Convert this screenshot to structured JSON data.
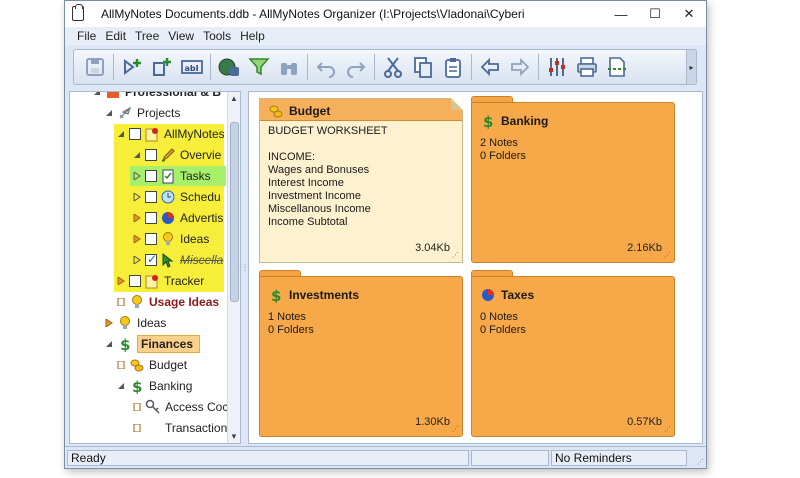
{
  "window": {
    "title": "AllMyNotes Documents.ddb - AllMyNotes Organizer (I:\\Projects\\Vladonai\\Cyberi",
    "controls": {
      "minimize": "—",
      "maximize": "☐",
      "close": "✕"
    }
  },
  "menu": [
    "File",
    "Edit",
    "Tree",
    "View",
    "Tools",
    "Help"
  ],
  "toolbar": {
    "buttons": [
      {
        "name": "save-icon",
        "color": "#8da2bf"
      },
      {
        "name": "add-note-icon",
        "color": "#2c8a2c"
      },
      {
        "name": "add-child-note-icon",
        "color": "#2c8a2c"
      },
      {
        "name": "rename-icon",
        "color": "#4a6a9a"
      },
      {
        "name": "web-search-icon",
        "color": "#2c8a2c"
      },
      {
        "name": "filter-search-icon",
        "color": "#2c8a2c"
      },
      {
        "name": "find-icon",
        "color": "#8da2bf"
      },
      {
        "name": "undo-icon",
        "color": "#8da2bf"
      },
      {
        "name": "redo-icon",
        "color": "#8da2bf"
      },
      {
        "name": "cut-icon",
        "color": "#4a6a9a"
      },
      {
        "name": "copy-icon",
        "color": "#4a6a9a"
      },
      {
        "name": "paste-icon",
        "color": "#4a6a9a"
      },
      {
        "name": "back-icon",
        "color": "#4a6a9a"
      },
      {
        "name": "forward-icon",
        "color": "#8da2bf"
      },
      {
        "name": "settings-sliders-icon",
        "color": "#c03020"
      },
      {
        "name": "print-icon",
        "color": "#4a6a9a"
      },
      {
        "name": "page-setup-icon",
        "color": "#2c8a2c"
      }
    ],
    "overflow": "▸"
  },
  "tree": {
    "items": [
      {
        "label": "Professional & B",
        "level": 0,
        "icon": "folder-icon",
        "partial": true
      },
      {
        "label": "Projects",
        "level": 1,
        "icon": "rocket-icon"
      },
      {
        "label": "AllMyNotes",
        "level": 2,
        "icon": "pin-note-icon",
        "checkbox": false,
        "highlight": "yellow"
      },
      {
        "label": "Overvie",
        "level": 3,
        "icon": "pencil-icon",
        "checkbox": false,
        "highlight": "yellow"
      },
      {
        "label": "Tasks",
        "level": 3,
        "icon": "checklist-icon",
        "checkbox": false,
        "highlight": "green"
      },
      {
        "label": "Schedu",
        "level": 3,
        "icon": "clock-icon",
        "checkbox": false,
        "highlight": "yellow"
      },
      {
        "label": "Advertis",
        "level": 3,
        "icon": "pie-chart-icon",
        "checkbox": false,
        "highlight": "yellow"
      },
      {
        "label": "Ideas",
        "level": 3,
        "icon": "lightbulb-icon",
        "checkbox": false,
        "highlight": "yellow"
      },
      {
        "label": "Miscella",
        "level": 3,
        "icon": "cursor-icon",
        "checkbox": true,
        "highlight": "yellow",
        "strike": true
      },
      {
        "label": "Tracker",
        "level": 2,
        "icon": "pin-note-icon",
        "checkbox": false
      },
      {
        "label": "Usage Ideas",
        "level": 2,
        "icon": "lightbulb-icon",
        "bold": true
      },
      {
        "label": "Ideas",
        "level": 1,
        "icon": "lightbulb-icon"
      },
      {
        "label": "Finances",
        "level": 1,
        "icon": "dollar-icon",
        "selected": true
      },
      {
        "label": "Budget",
        "level": 2,
        "icon": "coins-icon"
      },
      {
        "label": "Banking",
        "level": 2,
        "icon": "dollar-icon"
      },
      {
        "label": "Access Coc",
        "level": 3,
        "icon": "key-icon"
      },
      {
        "label": "Transactions",
        "level": 3,
        "icon": "note-icon"
      }
    ]
  },
  "cards": [
    {
      "kind": "note",
      "title": "Budget",
      "icon": "coins-icon",
      "lines": [
        "BUDGET WORKSHEET",
        "",
        "INCOME:",
        "Wages and Bonuses",
        "Interest Income",
        "Investment Income",
        "Miscellanous Income",
        "Income Subtotal"
      ],
      "size": "3.04Kb"
    },
    {
      "kind": "folder",
      "title": "Banking",
      "icon": "dollar-icon",
      "lines": [
        "2 Notes",
        "0 Folders"
      ],
      "size": "2.16Kb"
    },
    {
      "kind": "folder",
      "title": "Investments",
      "icon": "dollar-icon",
      "lines": [
        "1 Notes",
        "0 Folders"
      ],
      "size": "1.30Kb"
    },
    {
      "kind": "folder",
      "title": "Taxes",
      "icon": "pie-chart-icon",
      "lines": [
        "0 Notes",
        "0 Folders"
      ],
      "size": "0.57Kb"
    }
  ],
  "status": {
    "left": "Ready",
    "middle": "",
    "right": "No Reminders"
  }
}
